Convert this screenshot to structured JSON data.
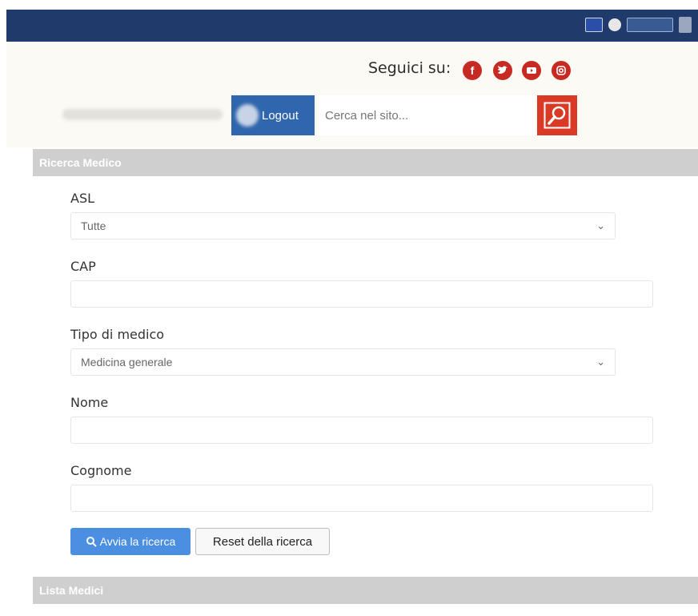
{
  "header": {
    "follow_label": "Seguici su:",
    "social": [
      {
        "name": "facebook-icon",
        "glyph": "f"
      },
      {
        "name": "twitter-icon",
        "glyph": "🐦"
      },
      {
        "name": "youtube-icon",
        "glyph": "▶"
      },
      {
        "name": "instagram-icon",
        "glyph": "◎"
      }
    ],
    "logout_label": "Logout",
    "search_placeholder": "Cerca nel sito..."
  },
  "panel": {
    "title": "Ricerca Medico",
    "fields": {
      "asl_label": "ASL",
      "asl_value": "Tutte",
      "cap_label": "CAP",
      "cap_value": "",
      "tipo_label": "Tipo di medico",
      "tipo_value": "Medicina generale",
      "nome_label": "Nome",
      "nome_value": "",
      "cognome_label": "Cognome",
      "cognome_value": ""
    },
    "search_button": "Avvia la ricerca",
    "reset_button": "Reset della ricerca"
  },
  "list": {
    "title": "Lista Medici"
  },
  "colors": {
    "topbar": "#1f3a6b",
    "accent_red": "#c62a22",
    "primary_blue": "#4a8fe1",
    "logout_blue": "#2f66ad"
  }
}
